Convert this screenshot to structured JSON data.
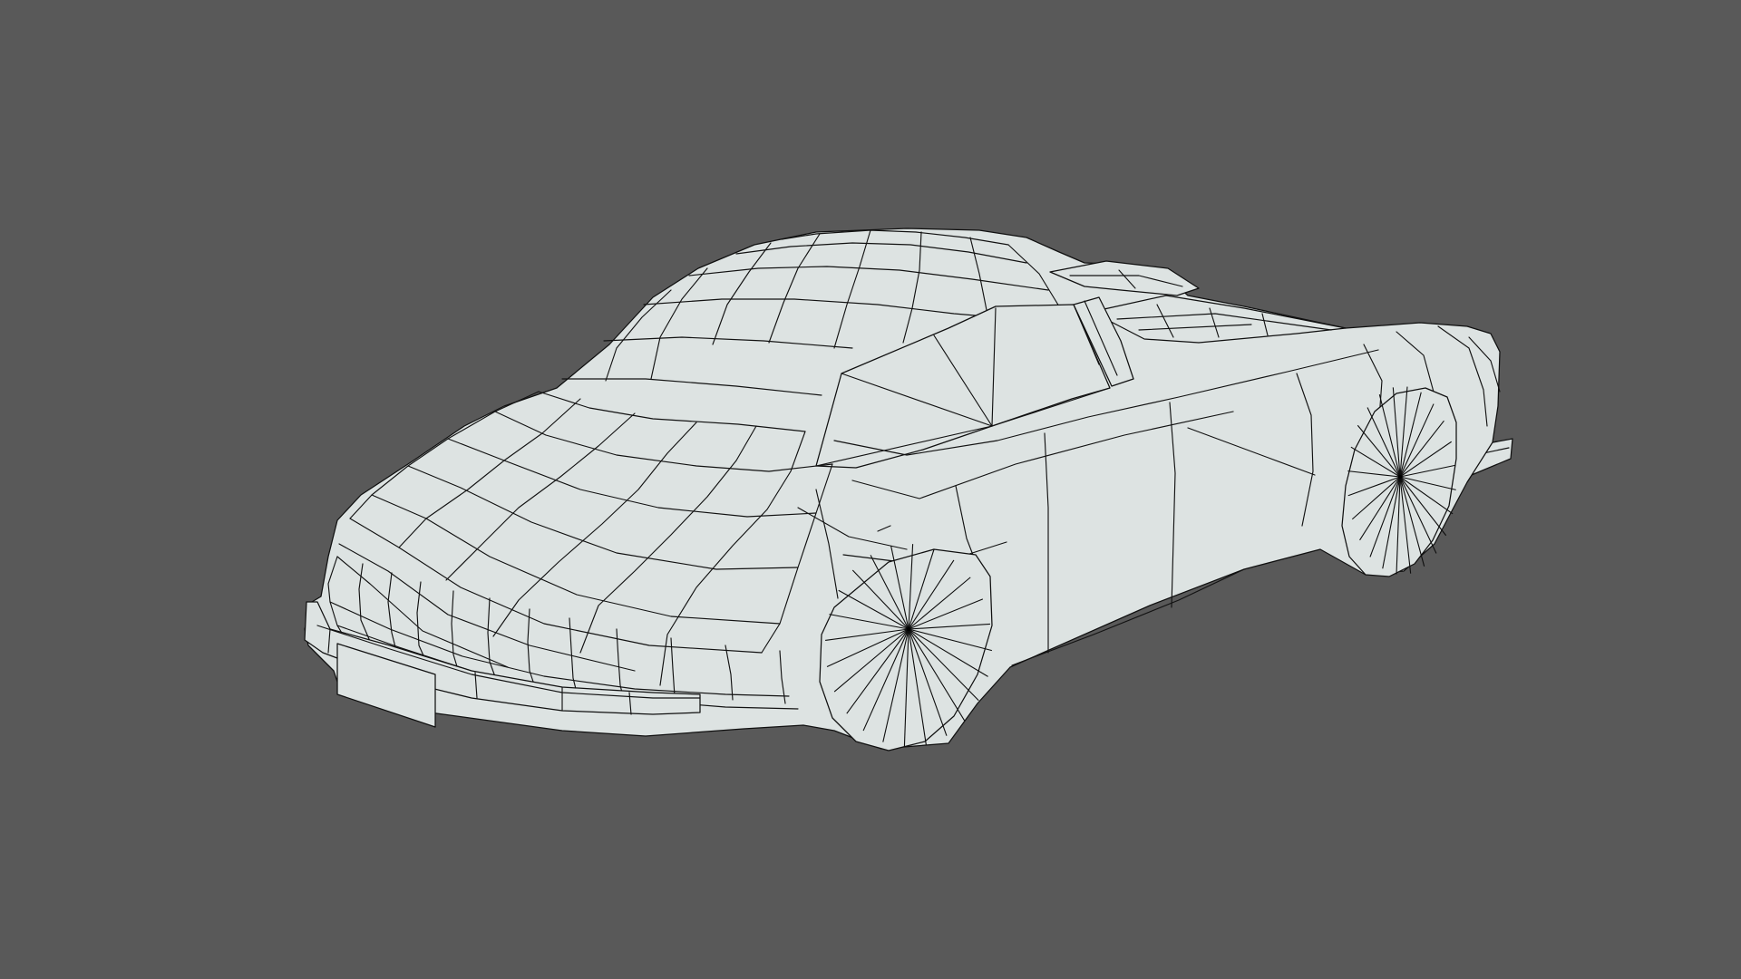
{
  "viewport": {
    "background_color": "#595959",
    "model": {
      "name": "",
      "display": "wireframe-on-shaded",
      "surface_color": "#dde3e2",
      "wire_color": "#101010",
      "parts": [
        "body",
        "roof",
        "hood",
        "windshield",
        "rear-window",
        "door",
        "front-bumper",
        "license-plate",
        "rear-bumper",
        "front-wheel",
        "rear-wheel"
      ],
      "wheel_spokes": 24
    }
  }
}
